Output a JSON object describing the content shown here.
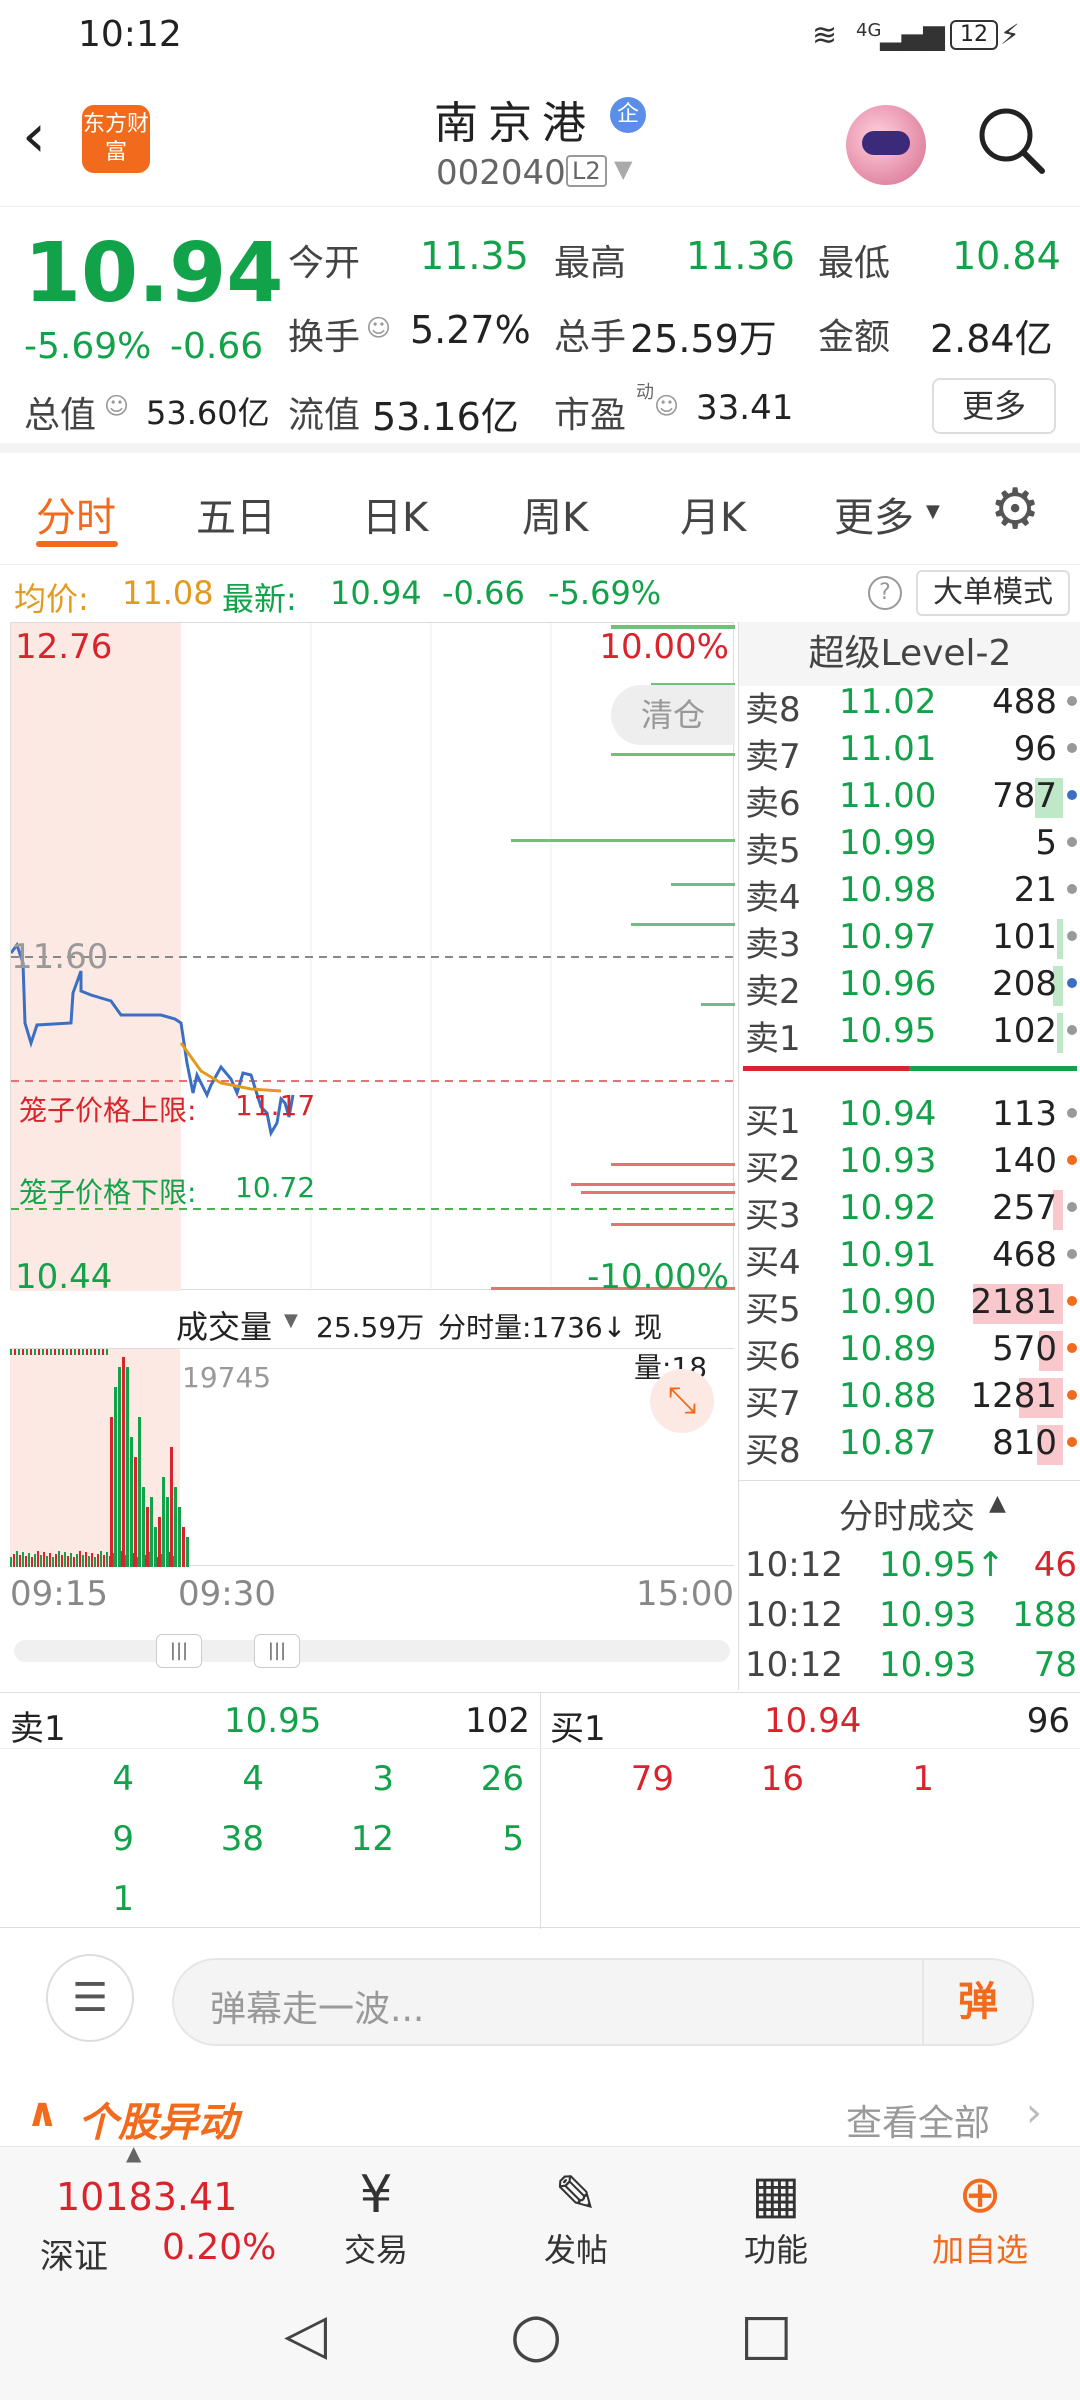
{
  "status": {
    "time": "10:12",
    "network": "4G",
    "battery": "12"
  },
  "header": {
    "stock_name": "南京港",
    "stock_badge": "企",
    "stock_code": "002040",
    "level_badge": "L2",
    "logo_text": "东方财富"
  },
  "quote": {
    "price": "10.94",
    "change_pct": "-5.69%",
    "change": "-0.66",
    "open_label": "今开",
    "open": "11.35",
    "high_label": "最高",
    "high": "11.36",
    "low_label": "最低",
    "low": "10.84",
    "turnover_label": "换手",
    "turnover": "5.27%",
    "volume_label": "总手",
    "volume": "25.59万",
    "amount_label": "金额",
    "amount": "2.84亿",
    "mktcap_label": "总值",
    "mktcap": "53.60亿",
    "float_label": "流值",
    "float": "53.16亿",
    "pe_label": "市盈",
    "pe_sup": "动",
    "pe": "33.41",
    "more_btn": "更多"
  },
  "tabs": [
    "分时",
    "五日",
    "日K",
    "周K",
    "月K",
    "更多"
  ],
  "infobar": {
    "avg_label": "均价:",
    "avg": "11.08",
    "latest_label": "最新:",
    "latest": "10.94",
    "change": "-0.66",
    "pct": "-5.69%",
    "mode_btn": "大单模式"
  },
  "chart": {
    "top_price": "12.76",
    "top_pct": "10.00%",
    "mid_price": "11.60",
    "bottom_price": "10.44",
    "bottom_pct": "-10.00%",
    "clear_btn": "清仓",
    "upper_limit_label": "笼子价格上限:",
    "upper_limit": "11.17",
    "lower_limit_label": "笼子价格下限:",
    "lower_limit": "10.72"
  },
  "volume_bar": {
    "label": "成交量",
    "total": "25.59万",
    "fen_label": "分时量:1736↓",
    "now_label": "现量:18",
    "peak": "19745"
  },
  "time_axis": {
    "t1": "09:15",
    "t2": "09:30",
    "t3": "15:00"
  },
  "book": {
    "title": "超级Level-2",
    "asks": [
      {
        "label": "卖8",
        "price": "11.02",
        "vol": "488"
      },
      {
        "label": "卖7",
        "price": "11.01",
        "vol": "96"
      },
      {
        "label": "卖6",
        "price": "11.00",
        "vol": "787"
      },
      {
        "label": "卖5",
        "price": "10.99",
        "vol": "5"
      },
      {
        "label": "卖4",
        "price": "10.98",
        "vol": "21"
      },
      {
        "label": "卖3",
        "price": "10.97",
        "vol": "101"
      },
      {
        "label": "卖2",
        "price": "10.96",
        "vol": "208"
      },
      {
        "label": "卖1",
        "price": "10.95",
        "vol": "102"
      }
    ],
    "bids": [
      {
        "label": "买1",
        "price": "10.94",
        "vol": "113"
      },
      {
        "label": "买2",
        "price": "10.93",
        "vol": "140"
      },
      {
        "label": "买3",
        "price": "10.92",
        "vol": "257"
      },
      {
        "label": "买4",
        "price": "10.91",
        "vol": "468"
      },
      {
        "label": "买5",
        "price": "10.90",
        "vol": "2181"
      },
      {
        "label": "买6",
        "price": "10.89",
        "vol": "570"
      },
      {
        "label": "买7",
        "price": "10.88",
        "vol": "1281"
      },
      {
        "label": "买8",
        "price": "10.87",
        "vol": "810"
      }
    ],
    "trades_title": "分时成交",
    "trades": [
      {
        "time": "10:12",
        "price": "10.95↑",
        "vol": "46"
      },
      {
        "time": "10:12",
        "price": "10.93",
        "vol": "188"
      },
      {
        "time": "10:12",
        "price": "10.93",
        "vol": "78"
      }
    ]
  },
  "queue": {
    "sell": {
      "label": "卖1",
      "price": "10.95",
      "vol": "102",
      "orders": [
        "4",
        "4",
        "3",
        "26",
        "9",
        "38",
        "12",
        "5",
        "1"
      ]
    },
    "buy": {
      "label": "买1",
      "price": "10.94",
      "vol": "96",
      "orders": [
        "79",
        "16",
        "1"
      ]
    }
  },
  "danmu": {
    "placeholder": "弹幕走一波...",
    "btn": "弹"
  },
  "abnormal": {
    "title": "个股异动",
    "view_all": "查看全部"
  },
  "bottom_nav": {
    "index_value": "10183.41",
    "index_name": "深证",
    "index_pct": "0.20%",
    "trade": "交易",
    "post": "发帖",
    "func": "功能",
    "add": "加自选"
  },
  "colors": {
    "red": "#d9242d",
    "green": "#12a24a",
    "accent": "#f26a1b"
  }
}
